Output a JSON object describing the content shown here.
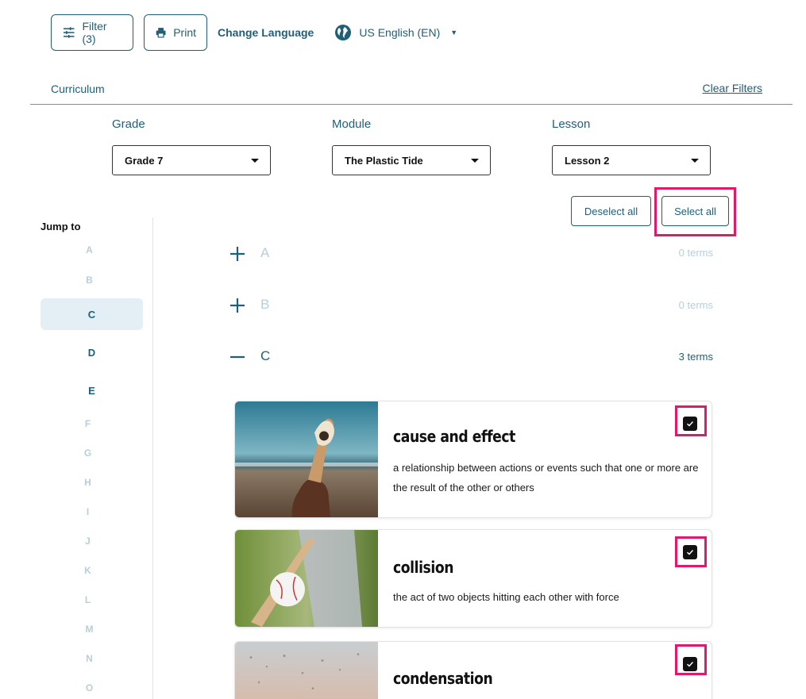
{
  "toolbar": {
    "filter_label": "Filter (3)",
    "print_label": "Print",
    "change_language": "Change Language",
    "language_value": "US English (EN)"
  },
  "curriculum": {
    "label": "Curriculum",
    "clear_filters": "Clear Filters"
  },
  "filters": {
    "grade": {
      "label": "Grade",
      "value": "Grade 7"
    },
    "module": {
      "label": "Module",
      "value": "The Plastic Tide"
    },
    "lesson": {
      "label": "Lesson",
      "value": "Lesson 2"
    }
  },
  "actions": {
    "deselect_all": "Deselect all",
    "select_all": "Select all"
  },
  "jump_to": {
    "title": "Jump to",
    "letters": [
      "A",
      "B",
      "C",
      "D",
      "E",
      "F",
      "G",
      "H",
      "I",
      "J",
      "K",
      "L",
      "M",
      "N",
      "O"
    ],
    "active": "C",
    "enabled": [
      "C",
      "D",
      "E"
    ]
  },
  "sections": [
    {
      "letter": "A",
      "count": "0 terms",
      "expanded": false
    },
    {
      "letter": "B",
      "count": "0 terms",
      "expanded": false
    },
    {
      "letter": "C",
      "count": "3 terms",
      "expanded": true
    }
  ],
  "terms": [
    {
      "title": "cause and effect",
      "definition": "a relationship between actions or events such that one or more are the result of the other or others",
      "checked": true,
      "image": "melting ice cream cone held at beach"
    },
    {
      "title": "collision",
      "definition": "the act of two objects hitting each other with force",
      "checked": true,
      "image": "baseball bat hitting ball"
    },
    {
      "title": "condensation",
      "definition": "",
      "checked": true,
      "image": "water droplets on window"
    }
  ],
  "colors": {
    "accent": "#1f5f78",
    "highlight": "#e0196d",
    "dim": "#b8cfd8",
    "active_bg": "#e4eff5"
  }
}
